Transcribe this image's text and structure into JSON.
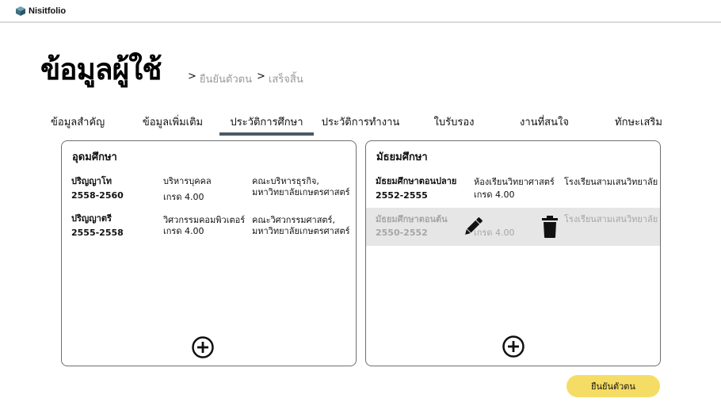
{
  "app": {
    "logo_text": "Nisitfolio"
  },
  "header": {
    "title": "ข้อมูลผู้ใช้",
    "steps": [
      {
        "sep": ">",
        "label": "ยืนยันตัวตน"
      },
      {
        "sep": ">",
        "label": "เสร็จสิ้น"
      }
    ]
  },
  "tabs": [
    {
      "label": "ข้อมูลสำคัญ"
    },
    {
      "label": "ข้อมูลเพิ่มเติม"
    },
    {
      "label": "ประวัติการศึกษา",
      "active": true
    },
    {
      "label": "ประวัติการทำงาน"
    },
    {
      "label": "ใบรับรอง"
    },
    {
      "label": "งานที่สนใจ"
    },
    {
      "label": "ทักษะเสริม"
    }
  ],
  "higher_ed": {
    "title": "อุดมศึกษา",
    "rows": [
      {
        "degree": "ปริญญาโท",
        "years": "2558-2560",
        "major": "บริหารบุคคล",
        "grade": "เกรด 4.00",
        "faculty_line1": "คณะบริหารธุรกิจ,",
        "faculty_line2": "มหาวิทยาลัยเกษตรศาสตร์"
      },
      {
        "degree": "ปริญญาตรี",
        "years": "2555-2558",
        "major": "วิศวกรรมคอมพิวเตอร์",
        "grade": "เกรด 4.00",
        "faculty_line1": "คณะวิศวกรรมศาสตร์,",
        "faculty_line2": "มหาวิทยาลัยเกษตรศาสตร์"
      }
    ]
  },
  "secondary_ed": {
    "title": "มัธยมศึกษา",
    "rows": [
      {
        "level": "มัธยมศึกษาตอนปลาย",
        "years": "2552-2555",
        "program": "ห้องเรียนวิทยาศาสตร์",
        "grade": "เกรด 4.00",
        "school": "โรงเรียนสามเสนวิทยาลัย"
      },
      {
        "level": "มัธยมศึกษาตอนต้น",
        "years": "2550-2552",
        "program": "",
        "grade": "เกรด 4.00",
        "school": "โรงเรียนสามเสนวิทยาลัย"
      }
    ]
  },
  "actions": {
    "confirm_label": "ยืนยันตัวตน"
  },
  "colors": {
    "accent": "#f5dc64",
    "tab_underline": "#4a5a66",
    "highlight_row": "#e6e6e6",
    "logo": "#4a7a8c"
  },
  "icons": {
    "add": "plus-circle-icon",
    "edit": "pencil-icon",
    "delete": "trash-icon",
    "logo": "cube-icon"
  }
}
